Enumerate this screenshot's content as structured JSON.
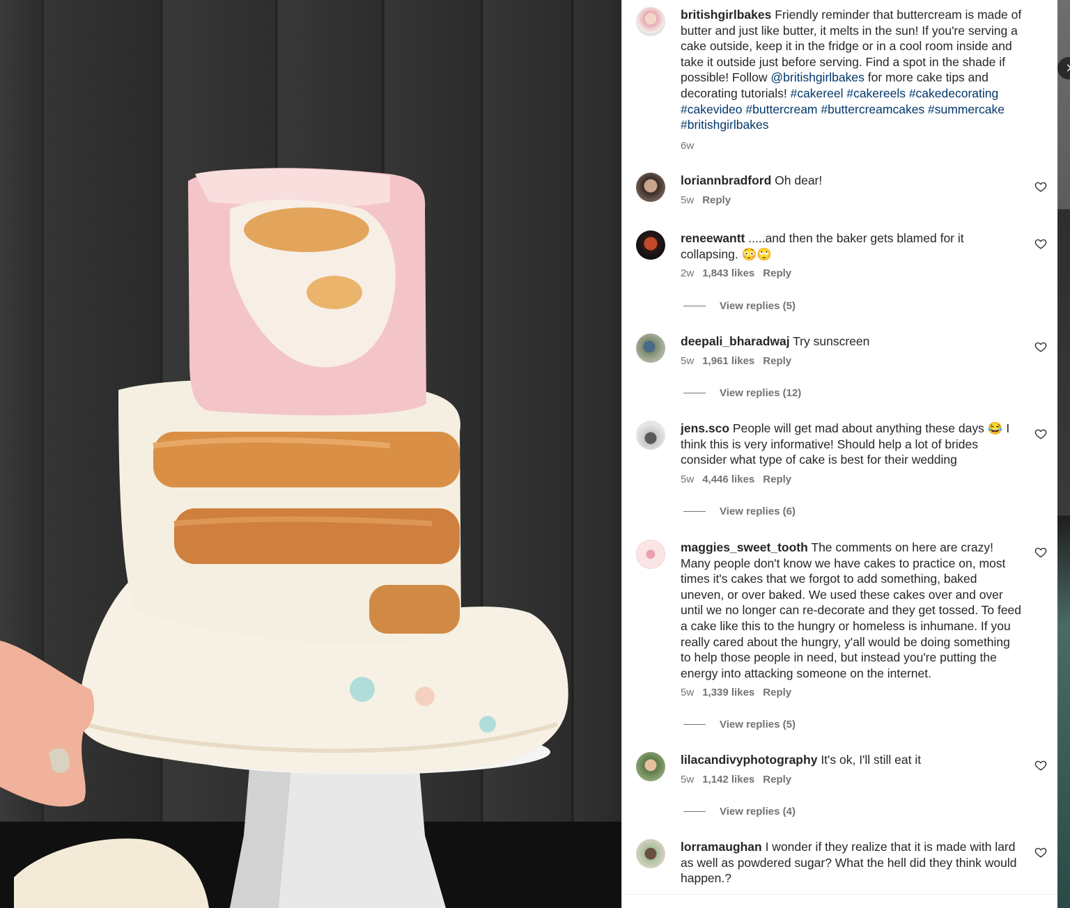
{
  "post": {
    "username": "britishgirlbakes",
    "caption_text": "Friendly reminder that buttercream is made of butter and just like butter, it melts in the sun! If you're serving a cake outside, keep it in the fridge or in a cool room inside and take it outside just before serving. Find a spot in the shade if possible! Follow ",
    "mention": "@britishgirlbakes",
    "caption_tail": " for more cake tips and decorating tutorials! ",
    "hashtags": "#cakereel #cakereels #cakedecorating #cakevideo #buttercream #buttercreamcakes #summercake #britishgirlbakes",
    "age": "6w"
  },
  "comments": [
    {
      "username": "loriannbradford",
      "text": "Oh dear!",
      "age": "5w",
      "likes": "",
      "reply_label": "Reply",
      "view_replies": ""
    },
    {
      "username": "reneewantt",
      "text": ".....and then the baker gets blamed for it collapsing. 😳🙄",
      "age": "2w",
      "likes": "1,843 likes",
      "reply_label": "Reply",
      "view_replies": "View replies (5)"
    },
    {
      "username": "deepali_bharadwaj",
      "text": "Try sunscreen",
      "age": "5w",
      "likes": "1,961 likes",
      "reply_label": "Reply",
      "view_replies": "View replies (12)"
    },
    {
      "username": "jens.sco",
      "text": "People will get mad about anything these days 😂 I think this is very informative! Should help a lot of brides consider what type of cake is best for their wedding",
      "age": "5w",
      "likes": "4,446 likes",
      "reply_label": "Reply",
      "view_replies": "View replies (6)"
    },
    {
      "username": "maggies_sweet_tooth",
      "text": "The comments on here are crazy! Many people don't know we have cakes to practice on, most times it's cakes that we forgot to add something, baked uneven, or over baked. We used these cakes over and over until we no longer can re-decorate and they get tossed. To feed a cake like this to the hungry or homeless is inhumane. If you really cared about the hungry, y'all would be doing something to help those people in need, but instead you're putting the energy into attacking someone on the internet.",
      "age": "5w",
      "likes": "1,339 likes",
      "reply_label": "Reply",
      "view_replies": "View replies (5)"
    },
    {
      "username": "lilacandivyphotography",
      "text": "It's ok, I'll still eat it",
      "age": "5w",
      "likes": "1,142 likes",
      "reply_label": "Reply",
      "view_replies": "View replies (4)"
    },
    {
      "username": "lorramaughan",
      "text": "I wonder if they realize that it is made with lard as well as powdered sugar? What the hell did they think would happen.?",
      "age": "",
      "likes": "",
      "reply_label": "",
      "view_replies": ""
    }
  ],
  "colors": {
    "link": "#00376b",
    "text": "#262626",
    "muted": "#737373"
  },
  "icons": {
    "like": "heart-outline-icon",
    "close": "close-icon"
  }
}
